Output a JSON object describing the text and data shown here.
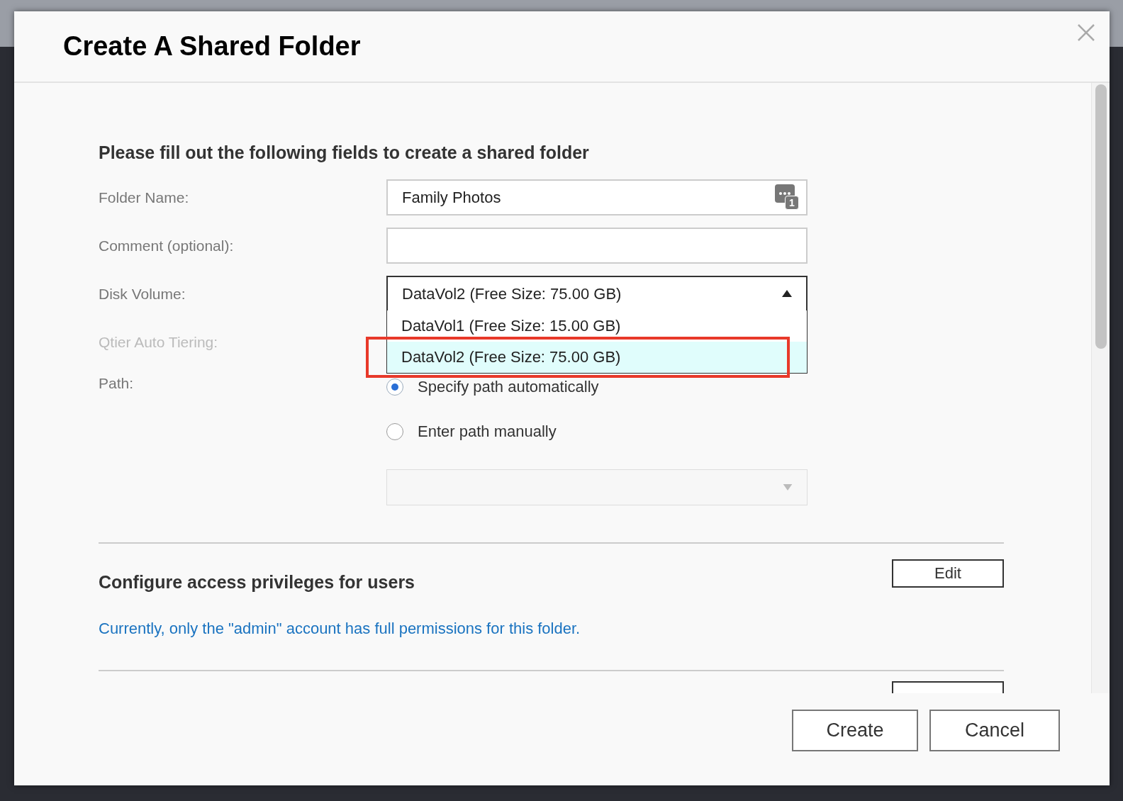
{
  "dialog": {
    "title": "Create A Shared Folder"
  },
  "form": {
    "heading": "Please fill out the following fields to create a shared folder",
    "folder_name": {
      "label": "Folder Name:",
      "value": "Family Photos",
      "badge": "1"
    },
    "comment": {
      "label": "Comment (optional):"
    },
    "disk_volume": {
      "label": "Disk Volume:",
      "value": "DataVol2 (Free Size: 75.00 GB)",
      "expanded": true,
      "options": [
        {
          "label": "DataVol1 (Free Size: 15.00 GB)",
          "selected": false,
          "highlighted": false
        },
        {
          "label": "DataVol2 (Free Size: 75.00 GB)",
          "selected": true,
          "highlighted": true
        }
      ]
    },
    "qtier": {
      "label": "Qtier Auto Tiering:",
      "disabled": true
    },
    "path": {
      "label": "Path:",
      "options": [
        {
          "label": "Specify path automatically",
          "selected": true
        },
        {
          "label": "Enter path manually",
          "selected": false
        }
      ],
      "path_select_disabled": true
    }
  },
  "privileges": {
    "heading": "Configure access privileges for users",
    "edit_button": "Edit",
    "note": "Currently, only the \"admin\" account has full permissions for this folder."
  },
  "buttons": [
    "Create",
    "Cancel"
  ]
}
